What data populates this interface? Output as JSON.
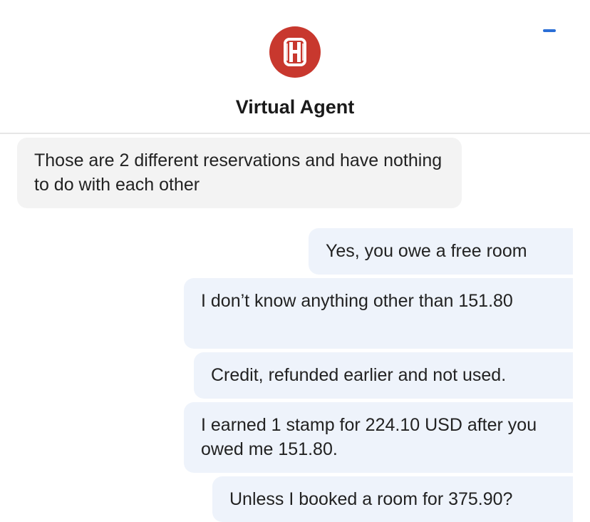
{
  "header": {
    "title": "Virtual Agent",
    "minimize_icon": "minimize-icon",
    "logo_icon": "hotel-logo-icon",
    "accent": "#c8382e"
  },
  "messages": [
    {
      "from": "agent",
      "text": "Those are 2 different reservations and have nothing to do with each other"
    },
    {
      "from": "user",
      "text": "Yes, you owe a free room"
    },
    {
      "from": "user",
      "text": "I don’t know anything other than 151.80"
    },
    {
      "from": "user",
      "text": "Credit, refunded earlier and not used."
    },
    {
      "from": "user",
      "text": "I earned 1 stamp for 224.10 USD after you owed me 151.80."
    },
    {
      "from": "user",
      "text": "Unless I booked a room for 375.90?"
    }
  ]
}
